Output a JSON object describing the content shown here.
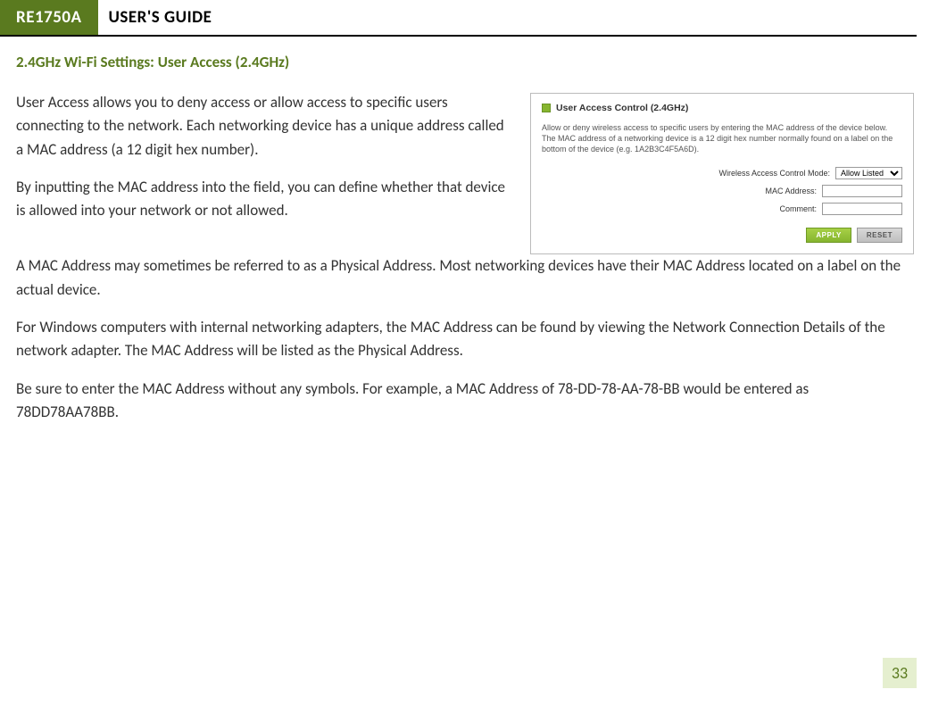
{
  "header": {
    "model": "RE1750A",
    "title": "USER'S GUIDE"
  },
  "section_title": "2.4GHz Wi-Fi Settings: User Access (2.4GHz)",
  "paragraphs": {
    "p1": "User Access allows you to deny access or allow access to specific users connecting to the network. Each networking device has a unique address called a MAC address (a 12 digit hex number).",
    "p2": "By inputting the MAC address into the field, you can define whether that device is allowed into your network or not allowed.",
    "p3": "A MAC Address may sometimes be referred to as a Physical Address. Most networking devices have their MAC Address located on a label on the actual device.",
    "p4": "For Windows computers with internal networking adapters, the MAC Address can be found by viewing the Network Connection Details of the network adapter. The MAC Address will be listed as the Physical Address.",
    "p5": "Be sure to enter the MAC Address without any symbols. For example, a MAC Address of 78-DD-78-AA-78-BB would be entered as 78DD78AA78BB."
  },
  "panel": {
    "title": "User Access Control (2.4GHz)",
    "description": "Allow or deny wireless access to specific users by entering the MAC address of the device below. The MAC address of a networking device is a 12 digit hex number normally found on a label on the bottom of the device (e.g. 1A2B3C4F5A6D).",
    "fields": {
      "mode_label": "Wireless Access Control Mode:",
      "mode_value": "Allow Listed",
      "mac_label": "MAC Address:",
      "mac_value": "",
      "comment_label": "Comment:",
      "comment_value": ""
    },
    "buttons": {
      "apply": "APPLY",
      "reset": "RESET"
    }
  },
  "page_number": "33"
}
